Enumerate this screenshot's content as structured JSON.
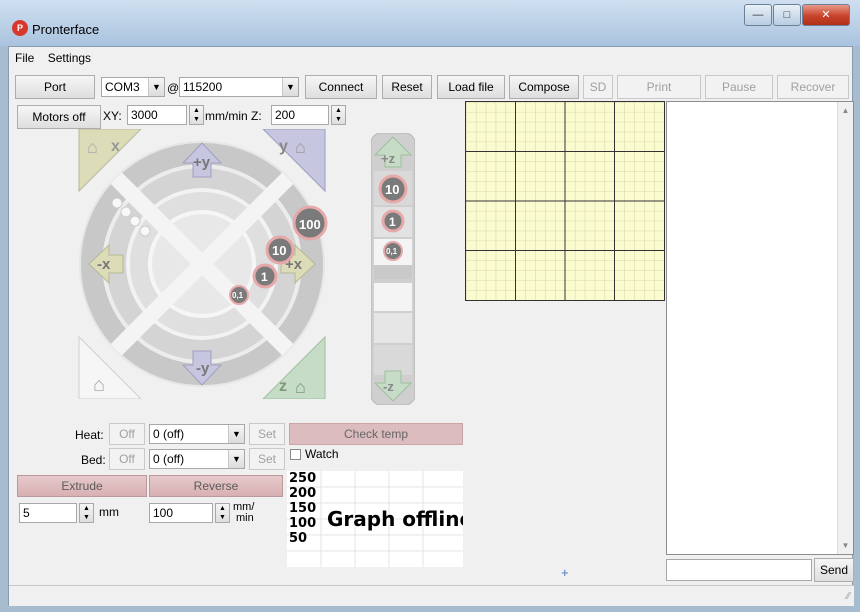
{
  "window": {
    "title": "Pronterface",
    "app_icon_text": "P"
  },
  "menu": {
    "file": "File",
    "settings": "Settings"
  },
  "toolbar": {
    "port_label": "Port",
    "port_value": "COM3",
    "at_sign": "@",
    "baud_value": "115200",
    "connect": "Connect",
    "reset": "Reset",
    "load_file": "Load file",
    "compose": "Compose",
    "sd": "SD",
    "print": "Print",
    "pause": "Pause",
    "recover": "Recover"
  },
  "speed": {
    "motors_off": "Motors off",
    "xy_label": "XY:",
    "xy_value": "3000",
    "unit_label": "mm/min Z:",
    "z_value": "200"
  },
  "jog": {
    "home_x": "x",
    "home_y": "y",
    "home_z": "z",
    "plus_y": "+y",
    "minus_y": "-y",
    "minus_x": "-x",
    "plus_x": "+x",
    "step_100": "100",
    "step_10": "10",
    "step_1": "1",
    "step_01": "0,1",
    "plus_z": "+z",
    "minus_z": "-z",
    "z_step_10": "10",
    "z_step_1": "1",
    "z_step_01": "0,1"
  },
  "temps": {
    "heat_label": "Heat:",
    "heat_off": "Off",
    "heat_value": "0 (off)",
    "heat_set": "Set",
    "bed_label": "Bed:",
    "bed_off": "Off",
    "bed_value": "0 (off)",
    "bed_set": "Set",
    "check_temp": "Check temp",
    "watch_label": "Watch"
  },
  "extrude": {
    "extrude": "Extrude",
    "reverse": "Reverse",
    "length_value": "5",
    "length_unit": "mm",
    "feed_value": "100",
    "feed_unit_1": "mm/",
    "feed_unit_2": "min"
  },
  "graph": {
    "ticks": [
      "250",
      "200",
      "150",
      "100",
      "50"
    ],
    "offline_text": "Graph offline"
  },
  "console": {
    "send": "Send"
  },
  "colors": {
    "grid_fill": "#fbfbd0",
    "pink_button": "#dcbcbe",
    "jog_ring": "#c8c8c8"
  }
}
